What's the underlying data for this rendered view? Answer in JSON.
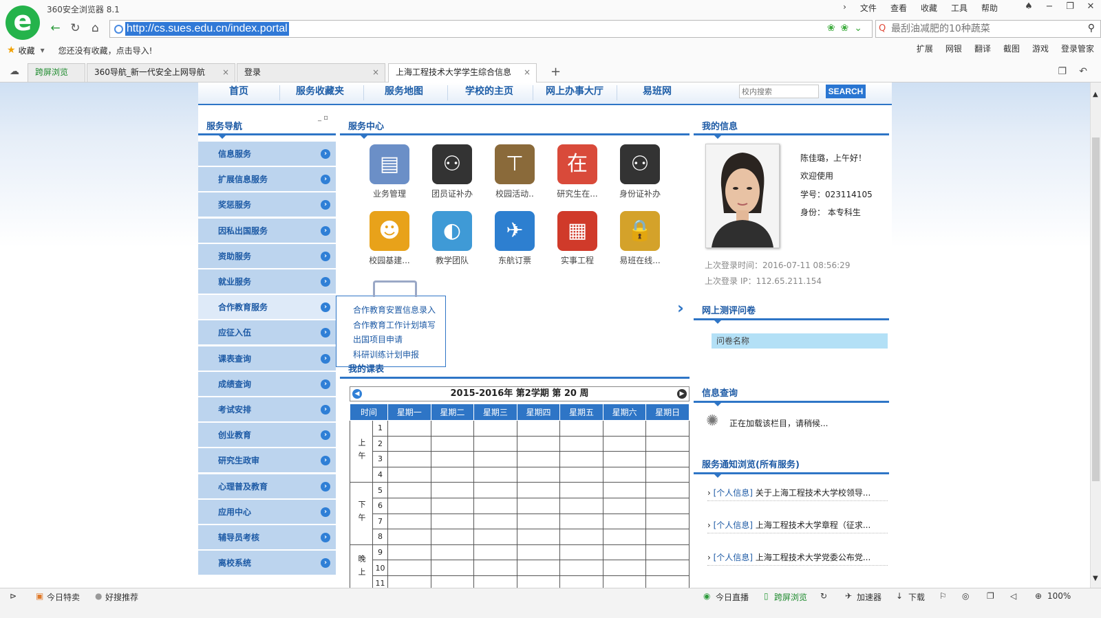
{
  "browser": {
    "title": "360安全浏览器 8.1",
    "menu": [
      "文件",
      "查看",
      "收藏",
      "工具",
      "帮助"
    ],
    "url": "http://cs.sues.edu.cn/index.portal",
    "search_placeholder": "最刮油减肥的10种蔬菜",
    "fav_label": "收藏",
    "fav_hint": "您还没有收藏，点击导入!",
    "toolbar": [
      "扩展",
      "网银",
      "翻译",
      "截图",
      "游戏",
      "登录管家"
    ],
    "tabs": [
      {
        "label": "跨屏浏览"
      },
      {
        "label": "360导航_新一代安全上网导航"
      },
      {
        "label": "登录"
      },
      {
        "label": "上海工程技术大学学生综合信息"
      }
    ]
  },
  "nav": {
    "items": [
      "首页",
      "服务收藏夹",
      "服务地图",
      "学校的主页",
      "网上办事大厅",
      "易班网"
    ],
    "search_placeholder": "校内搜索",
    "search_button": "SEARCH"
  },
  "sidebar": {
    "title": "服务导航",
    "items": [
      "信息服务",
      "扩展信息服务",
      "奖惩服务",
      "因私出国服务",
      "资助服务",
      "就业服务",
      "合作教育服务",
      "应征入伍",
      "课表查询",
      "成绩查询",
      "考试安排",
      "创业教育",
      "研究生政审",
      "心理普及教育",
      "应用中心",
      "辅导员考核",
      "离校系统"
    ],
    "highlighted_index": 6,
    "popup": [
      "合作教育安置信息录入",
      "合作教育工作计划填写",
      "出国项目申请",
      "科研训练计划申报"
    ]
  },
  "service_center": {
    "title": "服务中心",
    "services": [
      {
        "label": "业务管理",
        "icon": "business-icon",
        "color": "#6b8fc7"
      },
      {
        "label": "团员证补办",
        "icon": "people-desk-icon",
        "color": "#333333"
      },
      {
        "label": "校园活动..",
        "icon": "kiosk-icon",
        "color": "#8a6a3a"
      },
      {
        "label": "研究生在...",
        "icon": "stamp-icon",
        "color": "#d94a3a"
      },
      {
        "label": "身份证补办",
        "icon": "people-desk-icon",
        "color": "#333333"
      },
      {
        "label": "校园基建...",
        "icon": "worker-icon",
        "color": "#e8a21a"
      },
      {
        "label": "教学团队",
        "icon": "globe-icon",
        "color": "#3f9ad6"
      },
      {
        "label": "东航订票",
        "icon": "airplane-icon",
        "color": "#2d7fd0"
      },
      {
        "label": "实事工程",
        "icon": "calendar-icon",
        "color": "#d03a2a"
      },
      {
        "label": "易班在线...",
        "icon": "lock-icon",
        "color": "#d4a22a"
      }
    ]
  },
  "schedule": {
    "title_partial": "我的课表",
    "term": "2015-2016年 第2学期 第 20 周",
    "headers": [
      "时间",
      "星期一",
      "星期二",
      "星期三",
      "星期四",
      "星期五",
      "星期六",
      "星期日"
    ],
    "period_groups": [
      {
        "label": "上午",
        "periods": [
          "1",
          "2",
          "3",
          "4"
        ]
      },
      {
        "label": "下午",
        "periods": [
          "5",
          "6",
          "7",
          "8"
        ]
      },
      {
        "label": "晚上",
        "periods": [
          "9",
          "10",
          "11"
        ]
      }
    ]
  },
  "my_info": {
    "title": "我的信息",
    "greeting": "陈佳璐，上午好！",
    "welcome": "欢迎使用",
    "student_id": "学号：023114105",
    "identity": "身份： 本专科生",
    "last_login_time": "上次登录时间：2016-07-11 08:56:29",
    "last_login_ip": "上次登录 IP：112.65.211.154"
  },
  "survey": {
    "title": "网上测评问卷",
    "column": "问卷名称"
  },
  "info_query": {
    "title": "信息查询",
    "loading": "正在加载该栏目，请稍候..."
  },
  "notices": {
    "title": "服务通知浏览(所有服务)",
    "items": [
      {
        "tag": "[个人信息]",
        "text": "关于上海工程技术大学校领导..."
      },
      {
        "tag": "[个人信息]",
        "text": "上海工程技术大学章程（征求..."
      },
      {
        "tag": "[个人信息]",
        "text": "上海工程技术大学党委公布党..."
      }
    ]
  },
  "statusbar": {
    "left": [
      "今日特卖",
      "好搜推荐"
    ],
    "right": [
      "今日直播",
      "跨屏浏览",
      "加速器",
      "下载",
      "100%"
    ]
  }
}
